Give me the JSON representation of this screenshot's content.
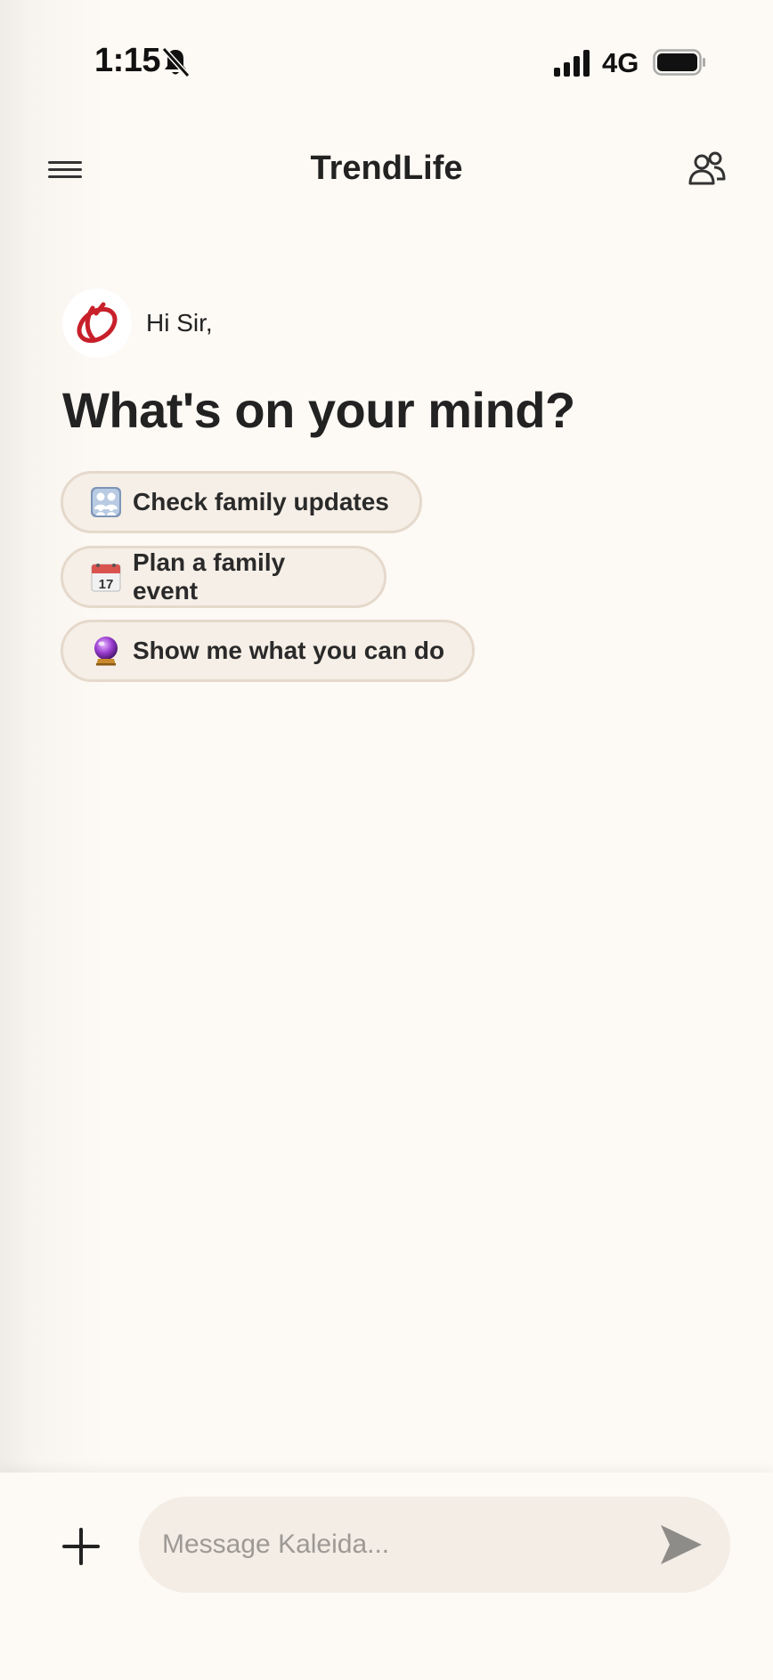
{
  "status_bar": {
    "time": "1:15",
    "network": "4G"
  },
  "header": {
    "title": "TrendLife"
  },
  "greeting": {
    "text": "Hi Sir,",
    "headline": "What's on your mind?"
  },
  "suggestions": [
    {
      "label": "Check family updates",
      "icon": "family-emoji-icon"
    },
    {
      "label": "Plan a family event",
      "icon": "calendar-emoji-icon"
    },
    {
      "label": "Show me what you can do",
      "icon": "crystal-ball-emoji-icon"
    }
  ],
  "composer": {
    "placeholder": "Message Kaleida..."
  },
  "colors": {
    "background": "#fdf9f4",
    "chip_bg": "#f6efe7",
    "chip_border": "#e5d9cc",
    "brand_red": "#c8202a"
  }
}
